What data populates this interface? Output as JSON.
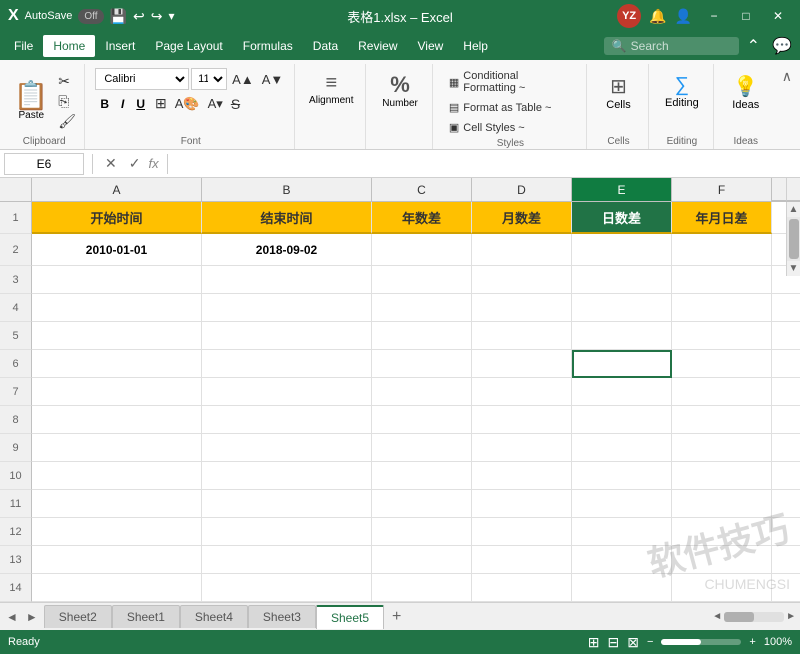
{
  "titlebar": {
    "autosave": "AutoSave",
    "autosave_state": "Off",
    "filename": "表格1.xlsx – Excel",
    "avatar_initials": "YZ",
    "min_btn": "−",
    "max_btn": "□",
    "close_btn": "✕"
  },
  "menubar": {
    "items": [
      {
        "label": "File",
        "id": "file"
      },
      {
        "label": "Home",
        "id": "home",
        "active": true
      },
      {
        "label": "Insert",
        "id": "insert"
      },
      {
        "label": "Page Layout",
        "id": "page-layout"
      },
      {
        "label": "Formulas",
        "id": "formulas"
      },
      {
        "label": "Data",
        "id": "data"
      },
      {
        "label": "Review",
        "id": "review"
      },
      {
        "label": "View",
        "id": "view"
      },
      {
        "label": "Help",
        "id": "help"
      }
    ],
    "search_placeholder": "Search"
  },
  "ribbon": {
    "clipboard_label": "Clipboard",
    "paste_label": "Paste",
    "font_label": "Font",
    "font_name": "Calibri",
    "font_size": "11",
    "alignment_label": "Alignment",
    "number_label": "Number",
    "styles_label": "Styles",
    "conditional_formatting": "Conditional Formatting ~",
    "format_as_table": "Format as Table ~",
    "cell_styles": "Cell Styles ~",
    "cells_label": "Cells",
    "cells_btn": "Cells",
    "editing_label": "Editing",
    "editing_btn": "Editing",
    "ideas_label": "Ideas",
    "ideas_btn": "Ideas"
  },
  "formula_bar": {
    "cell_ref": "E6",
    "fx": "fx",
    "formula_value": ""
  },
  "spreadsheet": {
    "col_headers": [
      "A",
      "B",
      "C",
      "D",
      "E",
      "F"
    ],
    "selected_col": "E",
    "rows": [
      {
        "num": "1",
        "cells": [
          {
            "value": "开始时间",
            "type": "header"
          },
          {
            "value": "结束时间",
            "type": "header"
          },
          {
            "value": "年数差",
            "type": "header"
          },
          {
            "value": "月数差",
            "type": "header"
          },
          {
            "value": "日数差",
            "type": "header"
          },
          {
            "value": "年月日差",
            "type": "header"
          }
        ]
      },
      {
        "num": "2",
        "cells": [
          {
            "value": "2010-01-01",
            "type": "data"
          },
          {
            "value": "2018-09-02",
            "type": "data"
          },
          {
            "value": "",
            "type": "empty"
          },
          {
            "value": "",
            "type": "empty"
          },
          {
            "value": "",
            "type": "empty"
          },
          {
            "value": "",
            "type": "empty"
          }
        ]
      },
      {
        "num": "3",
        "cells": [
          {
            "value": ""
          },
          {
            "value": ""
          },
          {
            "value": ""
          },
          {
            "value": ""
          },
          {
            "value": ""
          },
          {
            "value": ""
          }
        ]
      },
      {
        "num": "4",
        "cells": [
          {
            "value": ""
          },
          {
            "value": ""
          },
          {
            "value": ""
          },
          {
            "value": ""
          },
          {
            "value": ""
          },
          {
            "value": ""
          }
        ]
      },
      {
        "num": "5",
        "cells": [
          {
            "value": ""
          },
          {
            "value": ""
          },
          {
            "value": ""
          },
          {
            "value": ""
          },
          {
            "value": ""
          },
          {
            "value": ""
          }
        ]
      },
      {
        "num": "6",
        "cells": [
          {
            "value": ""
          },
          {
            "value": ""
          },
          {
            "value": ""
          },
          {
            "value": ""
          },
          {
            "value": "",
            "type": "selected"
          },
          {
            "value": ""
          }
        ]
      },
      {
        "num": "7",
        "cells": [
          {
            "value": ""
          },
          {
            "value": ""
          },
          {
            "value": ""
          },
          {
            "value": ""
          },
          {
            "value": ""
          },
          {
            "value": ""
          }
        ]
      },
      {
        "num": "8",
        "cells": [
          {
            "value": ""
          },
          {
            "value": ""
          },
          {
            "value": ""
          },
          {
            "value": ""
          },
          {
            "value": ""
          },
          {
            "value": ""
          }
        ]
      },
      {
        "num": "9",
        "cells": [
          {
            "value": ""
          },
          {
            "value": ""
          },
          {
            "value": ""
          },
          {
            "value": ""
          },
          {
            "value": ""
          },
          {
            "value": ""
          }
        ]
      },
      {
        "num": "10",
        "cells": [
          {
            "value": ""
          },
          {
            "value": ""
          },
          {
            "value": ""
          },
          {
            "value": ""
          },
          {
            "value": ""
          },
          {
            "value": ""
          }
        ]
      },
      {
        "num": "11",
        "cells": [
          {
            "value": ""
          },
          {
            "value": ""
          },
          {
            "value": ""
          },
          {
            "value": ""
          },
          {
            "value": ""
          },
          {
            "value": ""
          }
        ]
      },
      {
        "num": "12",
        "cells": [
          {
            "value": ""
          },
          {
            "value": ""
          },
          {
            "value": ""
          },
          {
            "value": ""
          },
          {
            "value": ""
          },
          {
            "value": ""
          }
        ]
      },
      {
        "num": "13",
        "cells": [
          {
            "value": ""
          },
          {
            "value": ""
          },
          {
            "value": ""
          },
          {
            "value": ""
          },
          {
            "value": ""
          },
          {
            "value": ""
          }
        ]
      },
      {
        "num": "14",
        "cells": [
          {
            "value": ""
          },
          {
            "value": ""
          },
          {
            "value": ""
          },
          {
            "value": ""
          },
          {
            "value": ""
          },
          {
            "value": ""
          }
        ]
      }
    ]
  },
  "sheet_tabs": {
    "tabs": [
      "Sheet2",
      "Sheet1",
      "Sheet4",
      "Sheet3",
      "Sheet5"
    ],
    "active": "Sheet5"
  },
  "status_bar": {
    "status": "Ready",
    "layout_icons": [
      "grid",
      "page",
      "zoom"
    ],
    "zoom": "100%"
  },
  "watermark": {
    "line1": "软件技巧",
    "line2": "CHUMENGSI"
  }
}
